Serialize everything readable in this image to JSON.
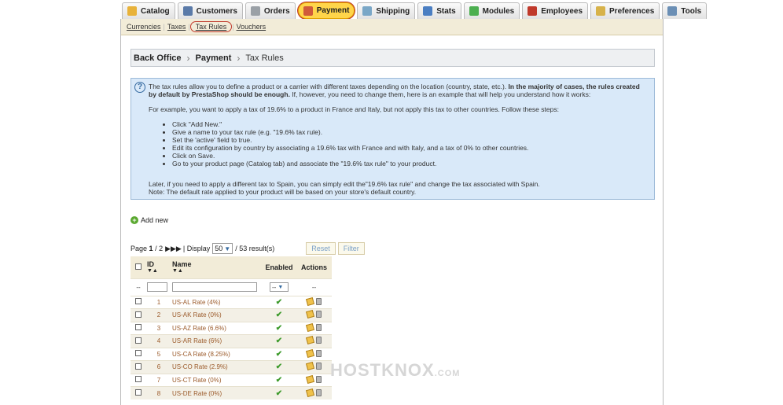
{
  "tabs": [
    {
      "label": "Catalog",
      "color": "#e8b23a"
    },
    {
      "label": "Customers",
      "color": "#5a7aa8"
    },
    {
      "label": "Orders",
      "color": "#9aa0a6"
    },
    {
      "label": "Payment",
      "color": "#d05a3a",
      "active": true
    },
    {
      "label": "Shipping",
      "color": "#7aa7c7"
    },
    {
      "label": "Stats",
      "color": "#4a7ec2"
    },
    {
      "label": "Modules",
      "color": "#4caf50"
    },
    {
      "label": "Employees",
      "color": "#c0392b"
    },
    {
      "label": "Preferences",
      "color": "#d7b24a"
    },
    {
      "label": "Tools",
      "color": "#6b8fb5"
    }
  ],
  "subnav": [
    "Currencies",
    "Taxes",
    "Tax Rules",
    "Vouchers"
  ],
  "breadcrumb": {
    "first": "Back Office",
    "second": "Payment",
    "current": "Tax Rules"
  },
  "hint": {
    "intro": "The tax rules allow you to define a product or a carrier with different taxes depending on the location (country, state, etc.).",
    "bold": "In the majority of cases, the rules created by default by PrestaShop should be enough.",
    "intro_tail": "If, however, you need to change them, here is an example that will help you understand how it works:",
    "example": "For example, you want to apply a tax of 19.6% to a product in France and Italy, but not apply this tax to other countries. Follow these steps:",
    "steps": [
      "Click \"Add New.\"",
      "Give a name to your tax rule (e.g. \"19.6% tax rule).",
      "Set the 'active' field to true.",
      "Edit its configuration by country by associating a 19.6% tax with France and with Italy, and a tax of 0% to other countries.",
      "Click on Save.",
      "Go to your product page (Catalog tab) and associate the \"19.6% tax rule\" to your product."
    ],
    "later": "Later, if you need to apply a different tax to Spain, you can simply edit the\"19.6% tax rule\" and change the tax associated with Spain.",
    "note": "Note: The default rate applied to your product will be based on your store's default country."
  },
  "add_new": "Add new",
  "pager": {
    "page_label": "Page",
    "page": "1",
    "total_pages": "/ 2",
    "display_label": "| Display",
    "per_page": "50",
    "results": "/ 53 result(s)",
    "reset": "Reset",
    "filter": "Filter"
  },
  "table": {
    "headers": {
      "id": "ID",
      "name": "Name",
      "enabled": "Enabled",
      "actions": "Actions"
    },
    "filter_placeholder": "--",
    "select_value": "--",
    "rows": [
      {
        "id": "1",
        "name": "US-AL Rate (4%)"
      },
      {
        "id": "2",
        "name": "US-AK Rate (0%)"
      },
      {
        "id": "3",
        "name": "US-AZ Rate (6.6%)"
      },
      {
        "id": "4",
        "name": "US-AR Rate (6%)"
      },
      {
        "id": "5",
        "name": "US-CA Rate (8.25%)"
      },
      {
        "id": "6",
        "name": "US-CO Rate (2.9%)"
      },
      {
        "id": "7",
        "name": "US-CT Rate (0%)"
      },
      {
        "id": "8",
        "name": "US-DE Rate (0%)"
      }
    ]
  },
  "watermark": {
    "main": "HOSTKNOX",
    "suffix": ".COM"
  }
}
